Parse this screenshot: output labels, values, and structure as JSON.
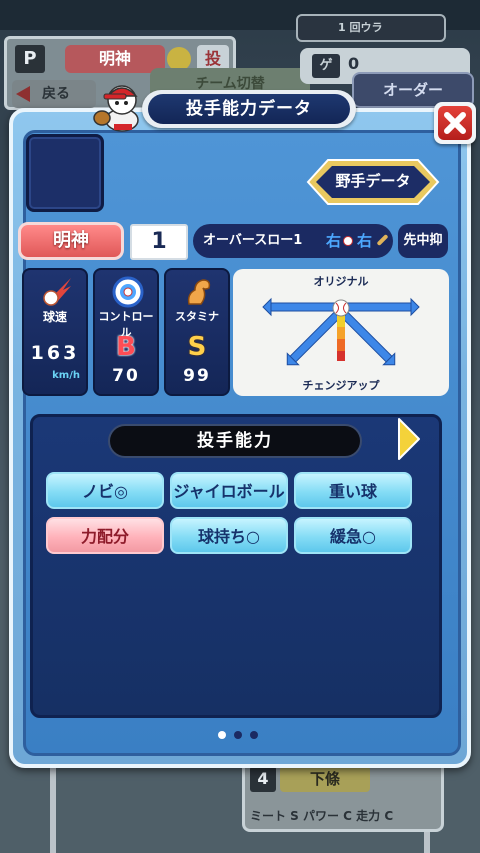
{
  "background": {
    "top_left_p": "P",
    "team_name": "明神",
    "pitcher_tag": "投",
    "back_button": "戻る",
    "team_change": "チーム切替",
    "inning": "1 回ウラ",
    "ge_label": "ゲ",
    "ge_value": "0",
    "order_button": "オーダー",
    "lineup_number": "4",
    "lineup_name": "下條",
    "lineup_stats": "ミート S パワー C 走力 C"
  },
  "dialog": {
    "title": "投手能力データ",
    "fielder_data_button": "野手データ",
    "team_badge": "明神",
    "uniform_number": "1",
    "throw_style": "オーバースロー1",
    "throw_hand": "右",
    "bat_hand": "右",
    "role": "先中抑",
    "stats": {
      "speed_label": "球速",
      "speed_value": "163",
      "speed_unit": "km/h",
      "control_label": "コントロール",
      "control_grade": "B",
      "control_value": "70",
      "stamina_label": "スタミナ",
      "stamina_grade": "S",
      "stamina_value": "99"
    },
    "pitch_chart": {
      "top_label": "オリジナル",
      "bottom_label": "チェンジアップ"
    },
    "ability_title": "投手能力",
    "abilities": [
      {
        "label": "ノビ◎",
        "style": "blue"
      },
      {
        "label": "ジャイロボール",
        "style": "blue"
      },
      {
        "label": "重い球",
        "style": "blue"
      },
      {
        "label": "力配分",
        "style": "red"
      },
      {
        "label": "球持ち○",
        "style": "blue"
      },
      {
        "label": "緩急○",
        "style": "blue"
      }
    ],
    "page_indicator": {
      "count": 3,
      "active": 0
    }
  },
  "colors": {
    "dialog_blue": "#3a7fc4",
    "navy": "#1b2a62",
    "grade_b": "#ff4d55",
    "grade_s": "#ffd04a",
    "skill_blue": "#84dcf5",
    "skill_red": "#ffb2ba",
    "close_red": "#d6302b"
  },
  "icons": {
    "close": "close-x-icon",
    "next": "next-arrow-icon",
    "speed": "fireball-icon",
    "control": "target-icon",
    "stamina": "flexed-arm-icon",
    "mascot": "pawapuro-player-icon"
  }
}
